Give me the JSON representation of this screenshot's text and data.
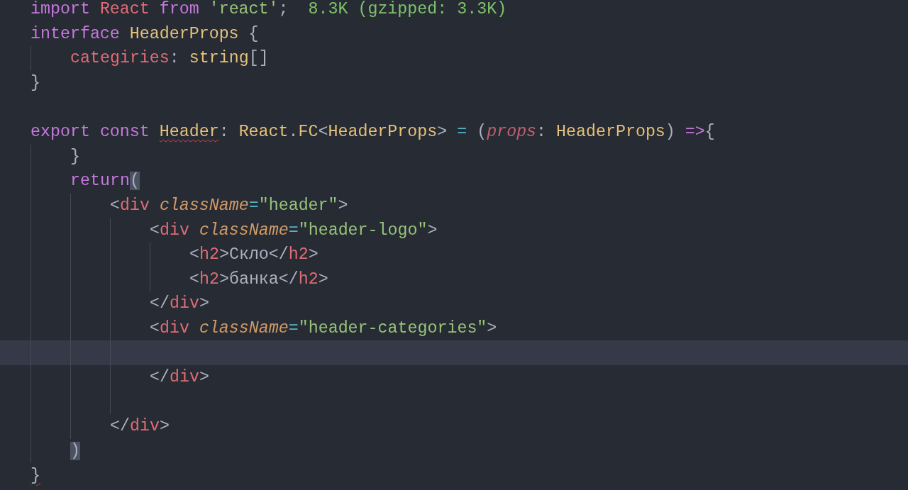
{
  "editor": {
    "lines": [
      {
        "kind": "code",
        "tokens": [
          {
            "t": "import ",
            "kind": "kw"
          },
          {
            "t": "React ",
            "kind": "tag"
          },
          {
            "t": "from ",
            "kind": "kw"
          },
          {
            "t": "'react'",
            "kind": "str"
          },
          {
            "t": ";",
            "kind": "plain"
          }
        ],
        "hint": "8.3K (gzipped: 3.3K)"
      },
      {
        "kind": "code",
        "tokens": [
          {
            "t": "interface ",
            "kind": "kw"
          },
          {
            "t": "HeaderProps",
            "kind": "type"
          },
          {
            "t": " {",
            "kind": "plain"
          }
        ]
      },
      {
        "kind": "code",
        "tokens": [
          {
            "t": "    categiries",
            "kind": "tag"
          },
          {
            "t": ": ",
            "kind": "plain"
          },
          {
            "t": "string",
            "kind": "type"
          },
          {
            "t": "[]",
            "kind": "plain"
          }
        ]
      },
      {
        "kind": "code",
        "tokens": [
          {
            "t": "}",
            "kind": "plain"
          }
        ]
      },
      {
        "kind": "blank"
      },
      {
        "kind": "code",
        "tokens": [
          {
            "t": "export ",
            "kind": "kw"
          },
          {
            "t": "const ",
            "kind": "kw"
          },
          {
            "t": "Header",
            "kind": "type",
            "error": true
          },
          {
            "t": ": ",
            "kind": "plain"
          },
          {
            "t": "React",
            "kind": "type"
          },
          {
            "t": ".",
            "kind": "plain"
          },
          {
            "t": "FC",
            "kind": "type"
          },
          {
            "t": "<",
            "kind": "plain"
          },
          {
            "t": "HeaderProps",
            "kind": "type"
          },
          {
            "t": "> ",
            "kind": "plain"
          },
          {
            "t": "=",
            "kind": "op"
          },
          {
            "t": " (",
            "kind": "plain"
          },
          {
            "t": "props",
            "kind": "param"
          },
          {
            "t": ": ",
            "kind": "plain"
          },
          {
            "t": "HeaderProps",
            "kind": "type"
          },
          {
            "t": ") ",
            "kind": "plain"
          },
          {
            "t": "=>",
            "kind": "kw"
          },
          {
            "t": "{",
            "kind": "plain"
          }
        ]
      },
      {
        "kind": "code",
        "tokens": [
          {
            "t": "    }",
            "kind": "plain"
          }
        ]
      },
      {
        "kind": "code",
        "tokens": [
          {
            "t": "    return",
            "kind": "kw"
          },
          {
            "t": "(",
            "kind": "plain",
            "matched": true
          }
        ]
      },
      {
        "kind": "code",
        "tokens": [
          {
            "t": "        <",
            "kind": "plain"
          },
          {
            "t": "div ",
            "kind": "tag"
          },
          {
            "t": "className",
            "kind": "attr"
          },
          {
            "t": "=",
            "kind": "op"
          },
          {
            "t": "\"header\"",
            "kind": "str"
          },
          {
            "t": ">",
            "kind": "plain"
          }
        ]
      },
      {
        "kind": "code",
        "tokens": [
          {
            "t": "            <",
            "kind": "plain"
          },
          {
            "t": "div ",
            "kind": "tag"
          },
          {
            "t": "className",
            "kind": "attr"
          },
          {
            "t": "=",
            "kind": "op"
          },
          {
            "t": "\"header-logo\"",
            "kind": "str"
          },
          {
            "t": ">",
            "kind": "plain"
          }
        ]
      },
      {
        "kind": "code",
        "tokens": [
          {
            "t": "                <",
            "kind": "plain"
          },
          {
            "t": "h2",
            "kind": "tag"
          },
          {
            "t": ">Скло</",
            "kind": "plain"
          },
          {
            "t": "h2",
            "kind": "tag"
          },
          {
            "t": ">",
            "kind": "plain"
          }
        ]
      },
      {
        "kind": "code",
        "tokens": [
          {
            "t": "                <",
            "kind": "plain"
          },
          {
            "t": "h2",
            "kind": "tag"
          },
          {
            "t": ">банка</",
            "kind": "plain"
          },
          {
            "t": "h2",
            "kind": "tag"
          },
          {
            "t": ">",
            "kind": "plain"
          }
        ]
      },
      {
        "kind": "code",
        "tokens": [
          {
            "t": "            </",
            "kind": "plain"
          },
          {
            "t": "div",
            "kind": "tag"
          },
          {
            "t": ">",
            "kind": "plain"
          }
        ]
      },
      {
        "kind": "code",
        "tokens": [
          {
            "t": "            <",
            "kind": "plain"
          },
          {
            "t": "div ",
            "kind": "tag"
          },
          {
            "t": "className",
            "kind": "attr"
          },
          {
            "t": "=",
            "kind": "op"
          },
          {
            "t": "\"header-categories\"",
            "kind": "str"
          },
          {
            "t": ">",
            "kind": "plain"
          }
        ]
      },
      {
        "kind": "blank",
        "current": true
      },
      {
        "kind": "code",
        "tokens": [
          {
            "t": "            </",
            "kind": "plain"
          },
          {
            "t": "div",
            "kind": "tag"
          },
          {
            "t": ">",
            "kind": "plain"
          }
        ]
      },
      {
        "kind": "blank"
      },
      {
        "kind": "code",
        "tokens": [
          {
            "t": "        </",
            "kind": "plain"
          },
          {
            "t": "div",
            "kind": "tag"
          },
          {
            "t": ">",
            "kind": "plain"
          }
        ]
      },
      {
        "kind": "code",
        "tokens": [
          {
            "t": "    )",
            "kind": "plain",
            "matched": true
          }
        ]
      },
      {
        "kind": "code",
        "tokens": [
          {
            "t": "}",
            "kind": "plain",
            "error": true
          }
        ]
      }
    ]
  }
}
